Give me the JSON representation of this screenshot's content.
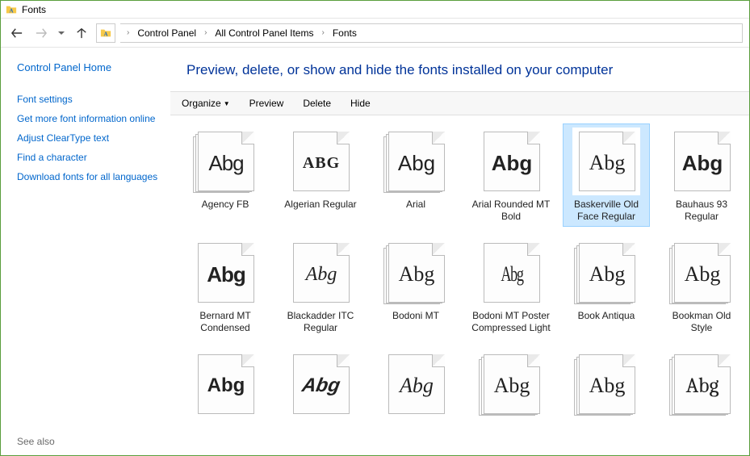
{
  "titlebar": {
    "title": "Fonts"
  },
  "nav": {
    "back_enabled": true,
    "forward_enabled": false
  },
  "breadcrumb": {
    "items": [
      "Control Panel",
      "All Control Panel Items",
      "Fonts"
    ]
  },
  "sidebar": {
    "home": "Control Panel Home",
    "links": [
      "Font settings",
      "Get more font information online",
      "Adjust ClearType text",
      "Find a character",
      "Download fonts for all languages"
    ],
    "seealso": "See also"
  },
  "main": {
    "title": "Preview, delete, or show and hide the fonts installed on your computer",
    "toolbar": {
      "organize": "Organize",
      "preview": "Preview",
      "delete": "Delete",
      "hide": "Hide"
    }
  },
  "fonts": [
    {
      "label": "Agency FB",
      "sample": "Abg",
      "stack": true,
      "selected": false,
      "style": "font-family:'Agency FB','Arial Narrow',sans-serif; font-weight:400; font-size:26px; letter-spacing:-1px;"
    },
    {
      "label": "Algerian Regular",
      "sample": "ABG",
      "stack": false,
      "selected": false,
      "style": "font-family:'Algerian','Wide Latin',serif; font-weight:700; font-size:20px; letter-spacing:1px;"
    },
    {
      "label": "Arial",
      "sample": "Abg",
      "stack": true,
      "selected": false,
      "style": "font-family:Arial,sans-serif; font-size:26px;"
    },
    {
      "label": "Arial Rounded MT Bold",
      "sample": "Abg",
      "stack": false,
      "selected": false,
      "style": "font-family:'Arial Rounded MT Bold',Arial,sans-serif; font-weight:900; font-size:26px;"
    },
    {
      "label": "Baskerville Old Face Regular",
      "sample": "Abg",
      "stack": false,
      "selected": true,
      "style": "font-family:'Baskerville Old Face','Times New Roman',serif; font-size:26px;"
    },
    {
      "label": "Bauhaus 93 Regular",
      "sample": "Abg",
      "stack": false,
      "selected": false,
      "style": "font-family:'Bauhaus 93','Arial Black',sans-serif; font-weight:900; font-size:26px;"
    },
    {
      "label": "Bernard MT Condensed",
      "sample": "Abg",
      "stack": false,
      "selected": false,
      "style": "font-family:'Bernard MT Condensed','Arial Narrow',sans-serif; font-weight:900; font-size:26px; letter-spacing:-1px;"
    },
    {
      "label": "Blackadder ITC Regular",
      "sample": "Abg",
      "stack": false,
      "selected": false,
      "style": "font-family:'Blackadder ITC','Brush Script MT',cursive; font-style:italic; font-size:24px;"
    },
    {
      "label": "Bodoni MT",
      "sample": "Abg",
      "stack": true,
      "selected": false,
      "style": "font-family:'Bodoni MT','Times New Roman',serif; font-size:26px;"
    },
    {
      "label": "Bodoni MT Poster Compressed Light",
      "sample": "Abg",
      "stack": false,
      "selected": false,
      "style": "font-family:'Bodoni MT Poster Compressed','Arial Narrow',serif; font-size:26px; letter-spacing:-2px; transform:scaleX(0.7);"
    },
    {
      "label": "Book Antiqua",
      "sample": "Abg",
      "stack": true,
      "selected": false,
      "style": "font-family:'Book Antiqua','Palatino Linotype',serif; font-size:26px;"
    },
    {
      "label": "Bookman Old Style",
      "sample": "Abg",
      "stack": true,
      "selected": false,
      "style": "font-family:'Bookman Old Style',serif; font-size:26px;"
    },
    {
      "label": "",
      "sample": "Abg",
      "stack": false,
      "selected": false,
      "style": "font-family:'Arial Black',sans-serif; font-weight:900; font-size:24px;"
    },
    {
      "label": "",
      "sample": "Abg",
      "stack": false,
      "selected": false,
      "style": "font-family:'Arial Black',sans-serif; font-weight:900; font-style:italic; font-size:24px; transform:skewX(-10deg);"
    },
    {
      "label": "",
      "sample": "Abg",
      "stack": false,
      "selected": false,
      "style": "font-family:'Brush Script MT',cursive; font-style:italic; font-size:26px;"
    },
    {
      "label": "",
      "sample": "Abg",
      "stack": true,
      "selected": false,
      "style": "font-family:'Times New Roman',serif; font-size:26px;"
    },
    {
      "label": "",
      "sample": "Abg",
      "stack": true,
      "selected": false,
      "style": "font-family:'Georgia',serif; font-size:26px;"
    },
    {
      "label": "",
      "sample": "Abg",
      "stack": true,
      "selected": false,
      "style": "font-family:'Cambria',serif; font-size:26px;"
    }
  ]
}
